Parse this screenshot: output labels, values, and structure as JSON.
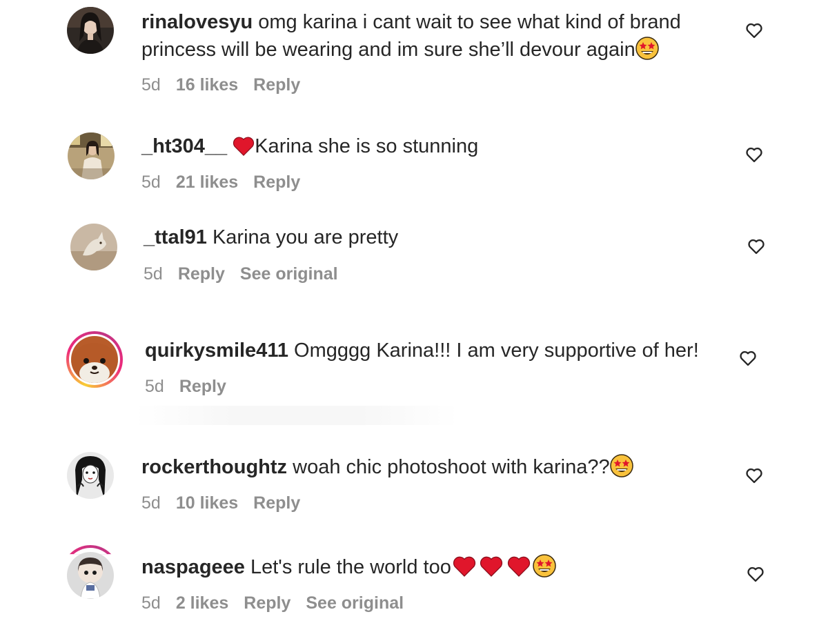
{
  "comments": [
    {
      "username": "rinalovesyu",
      "text_line1": "omg karina i cant wait to see what kind of brand",
      "text_line2": "princess will be wearing and im sure she’ll devour again",
      "emoji": "star-struck",
      "time": "5d",
      "likes": "16 likes",
      "reply": "Reply",
      "liked": false
    },
    {
      "username": "_ht304__",
      "emoji_prefix": "red-heart",
      "text": "Karina she is so stunning",
      "time": "5d",
      "likes": "21 likes",
      "reply": "Reply",
      "liked": false
    },
    {
      "username": "_ttal91",
      "text": "Karina you are pretty",
      "time": "5d",
      "reply": "Reply",
      "see_original": "See original",
      "liked": false
    },
    {
      "username": "quirkysmile411",
      "text": "Omgggg Karina!!! I am very supportive of her!",
      "time": "5d",
      "reply": "Reply",
      "has_story": true,
      "liked": false
    },
    {
      "username": "rockerthoughtz",
      "text": "woah chic photoshoot with karina??",
      "emoji": "star-struck",
      "time": "5d",
      "likes": "10 likes",
      "reply": "Reply",
      "liked": false
    },
    {
      "username": "naspageee",
      "text": "Let's rule the world too",
      "emojis": [
        "red-heart",
        "red-heart",
        "red-heart",
        "star-struck"
      ],
      "time": "5d",
      "likes": "2 likes",
      "reply": "Reply",
      "see_original": "See original",
      "liked": false
    }
  ],
  "colors": {
    "text": "#262626",
    "meta": "#8e8e8e",
    "heart_red": "#e0162b",
    "emoji_yellow": "#f9c23c"
  }
}
